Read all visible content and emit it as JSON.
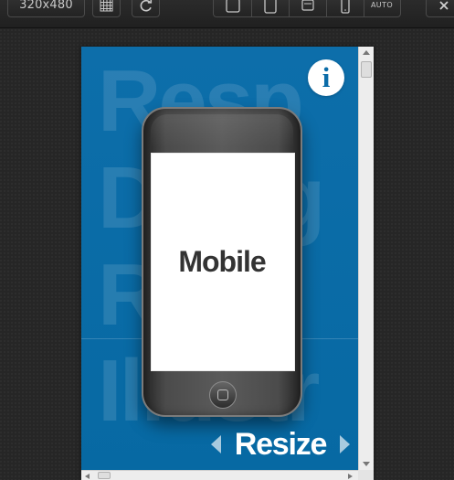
{
  "toolbar": {
    "resolution_label": "320x480",
    "buttons": [
      {
        "name": "grid-toggle",
        "icon": "grid-icon"
      },
      {
        "name": "rotate",
        "icon": "rotate-icon"
      },
      {
        "name": "tablet-landscape",
        "icon": "tablet-landscape-icon"
      },
      {
        "name": "tablet-portrait",
        "icon": "tablet-portrait-icon"
      },
      {
        "name": "small-landscape",
        "icon": "small-landscape-icon"
      },
      {
        "name": "mobile-portrait",
        "icon": "phone-portrait-icon"
      },
      {
        "name": "auto",
        "label": "AUTO"
      },
      {
        "name": "close",
        "icon": "close-icon"
      }
    ]
  },
  "content": {
    "background_words": [
      "Resp",
      "Desig",
      "Resp",
      "Illustr"
    ],
    "info_label": "i",
    "phone_label": "Mobile",
    "resize_label": "Resize"
  },
  "colors": {
    "page_background": "#262626",
    "accent_blue": "#0a6aa6",
    "phone_screen": "#ffffff",
    "text_dark": "#333333",
    "text_light": "#ffffff"
  }
}
